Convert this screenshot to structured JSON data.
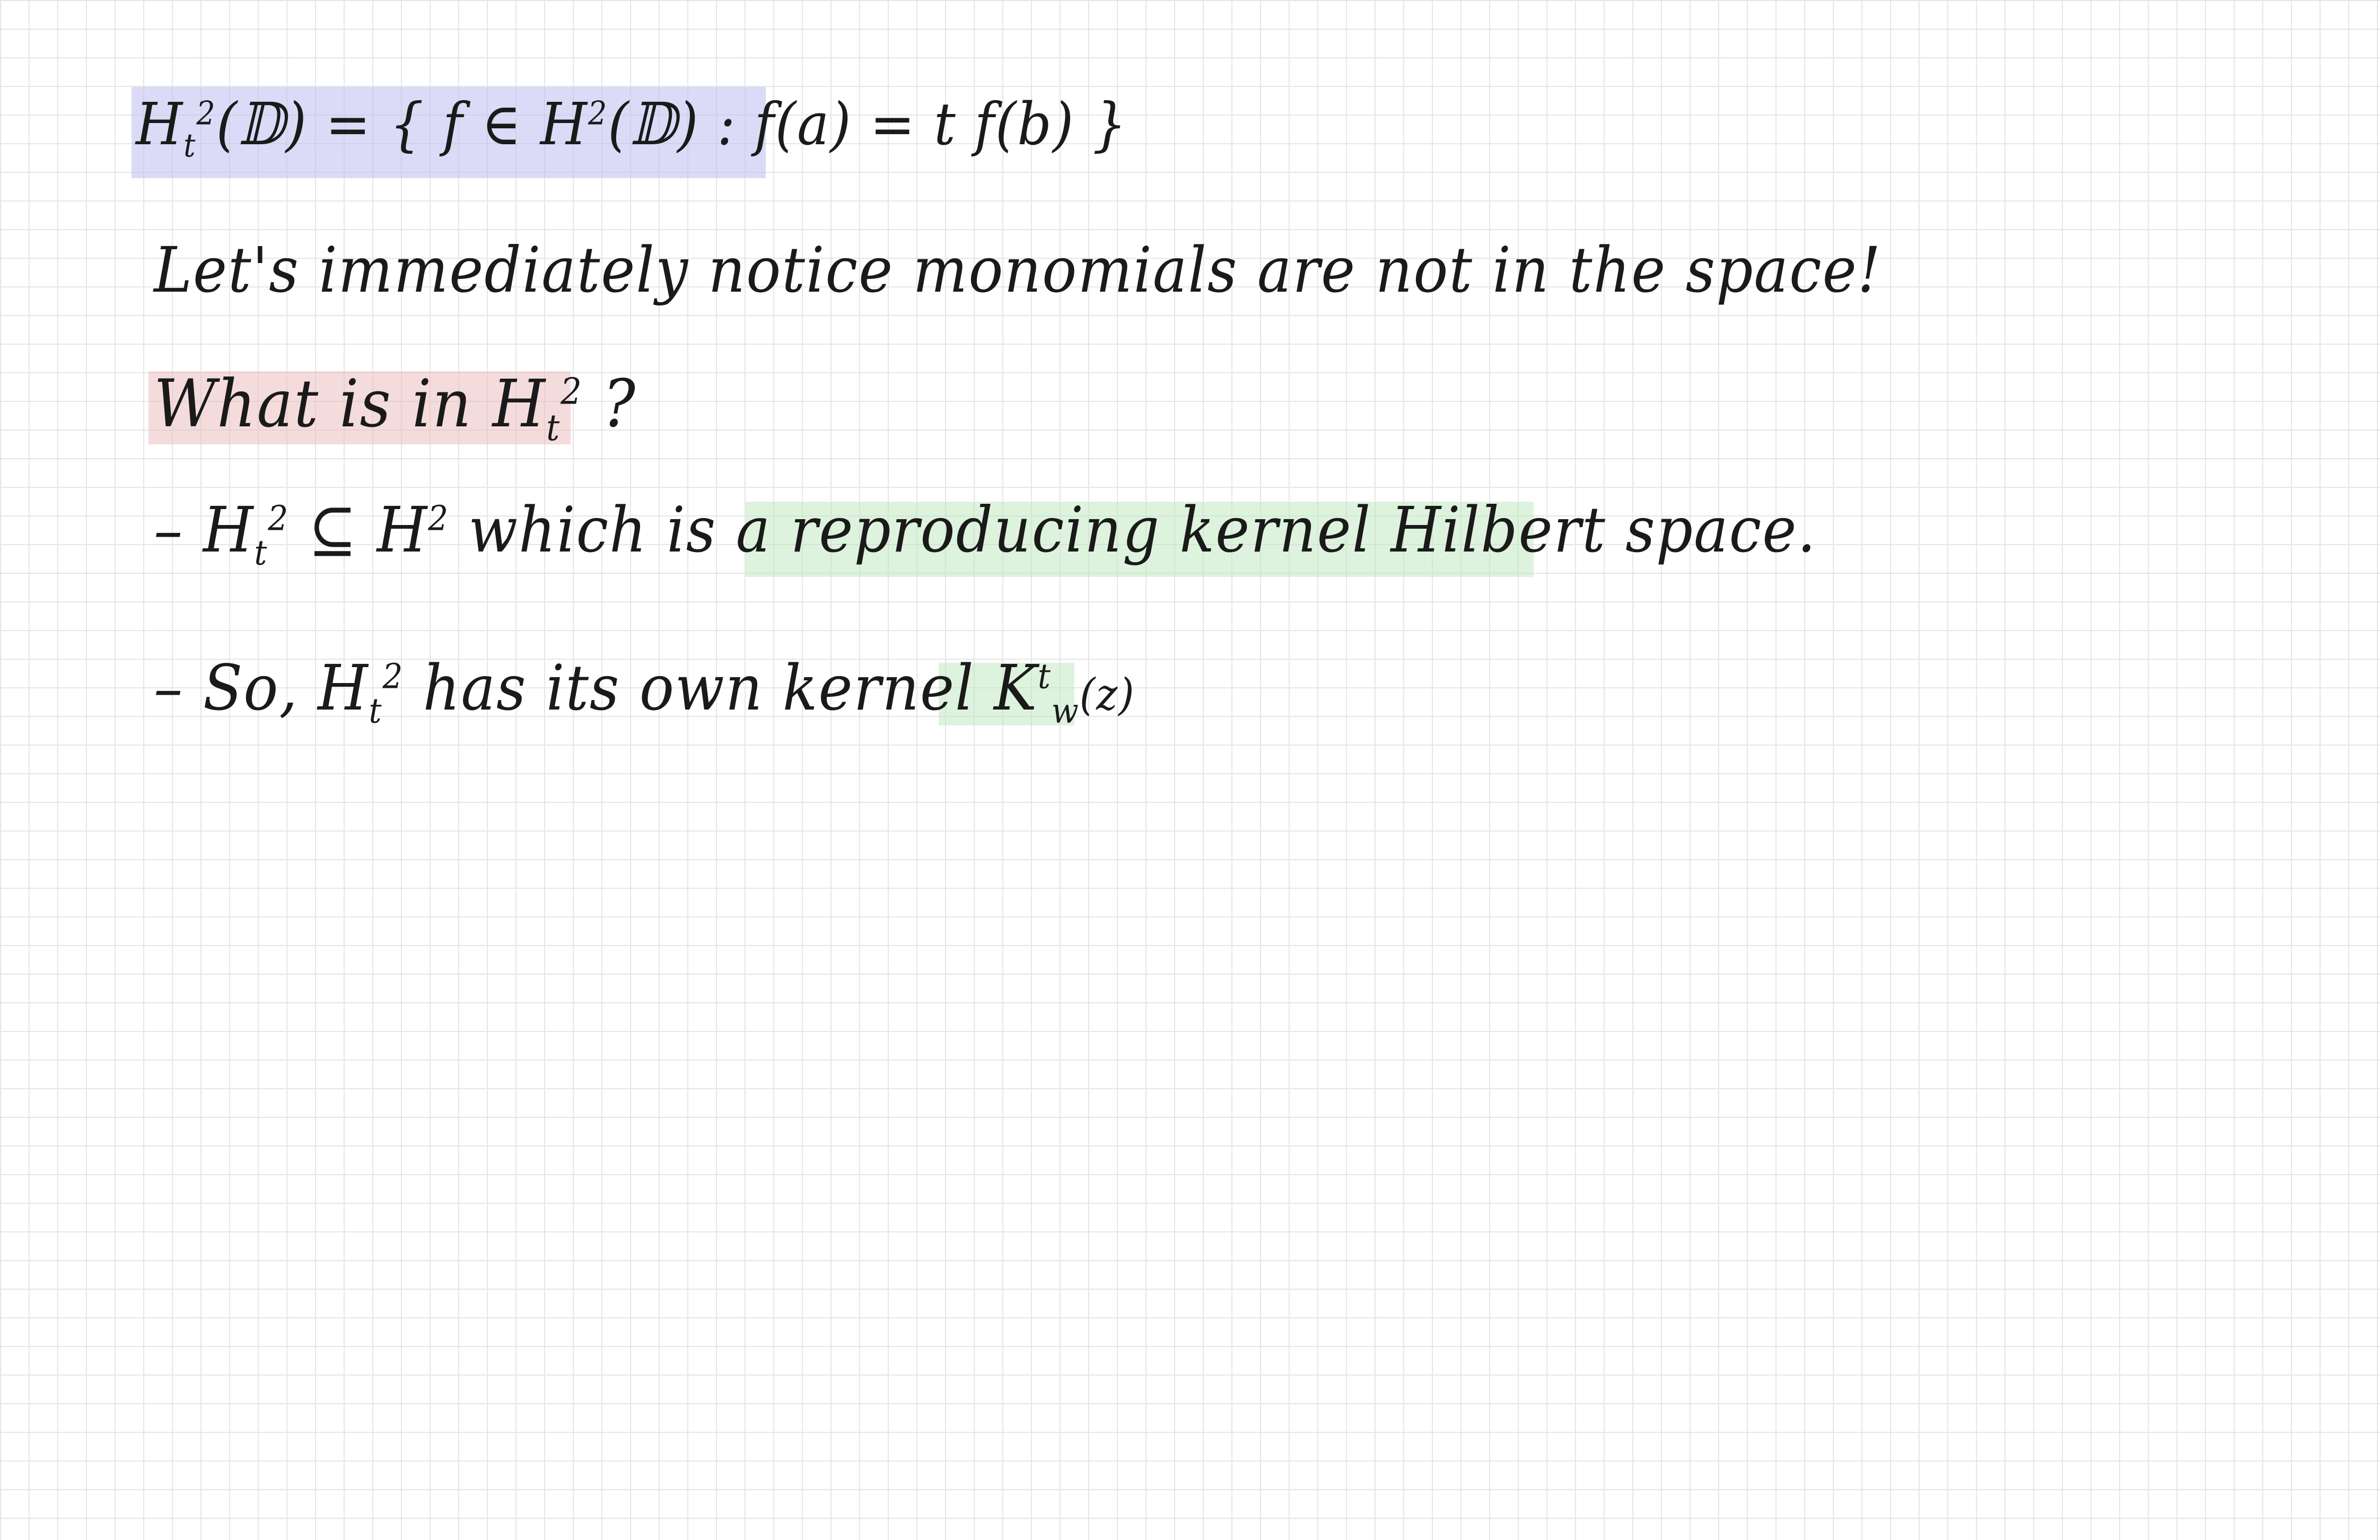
{
  "definition": {
    "space": "H",
    "space_sub": "t",
    "space_sup": "2",
    "domain": "(𝔻)",
    "set_open": " = { f ∈ ",
    "h_space": "H",
    "h_sup": "2",
    "h_domain": "(𝔻)",
    "condition": " : f(a) = t f(b) }"
  },
  "observation": {
    "text": "Let's  immediately notice  monomials are not  in the space!"
  },
  "question": {
    "lead": "What  is  in ",
    "space": "H",
    "sub": "t",
    "sup": "2",
    "tail": " ?"
  },
  "bullet1": {
    "dash": "–",
    "space": "H",
    "sub": "t",
    "sup": "2",
    "relation": " ⊆ ",
    "superspace": "H",
    "superspace_sup": "2",
    "middle": "  which  is  a ",
    "highlight": "reproducing  kernel Hilbert space."
  },
  "bullet2": {
    "dash": "–",
    "lead": "So, ",
    "space": "H",
    "sub": "t",
    "sup": "2",
    "middle": "  has  its  own  kernel ",
    "kernel": "K",
    "kernel_sup": "t",
    "kernel_sub": "w",
    "kernel_arg": "(z)"
  },
  "colors": {
    "ink": "#1a1a1a",
    "grid": "#e6e6e6",
    "highlight_purple": "#c8c8f0",
    "highlight_red": "#f0cccc",
    "highlight_green": "#d3efd3"
  }
}
